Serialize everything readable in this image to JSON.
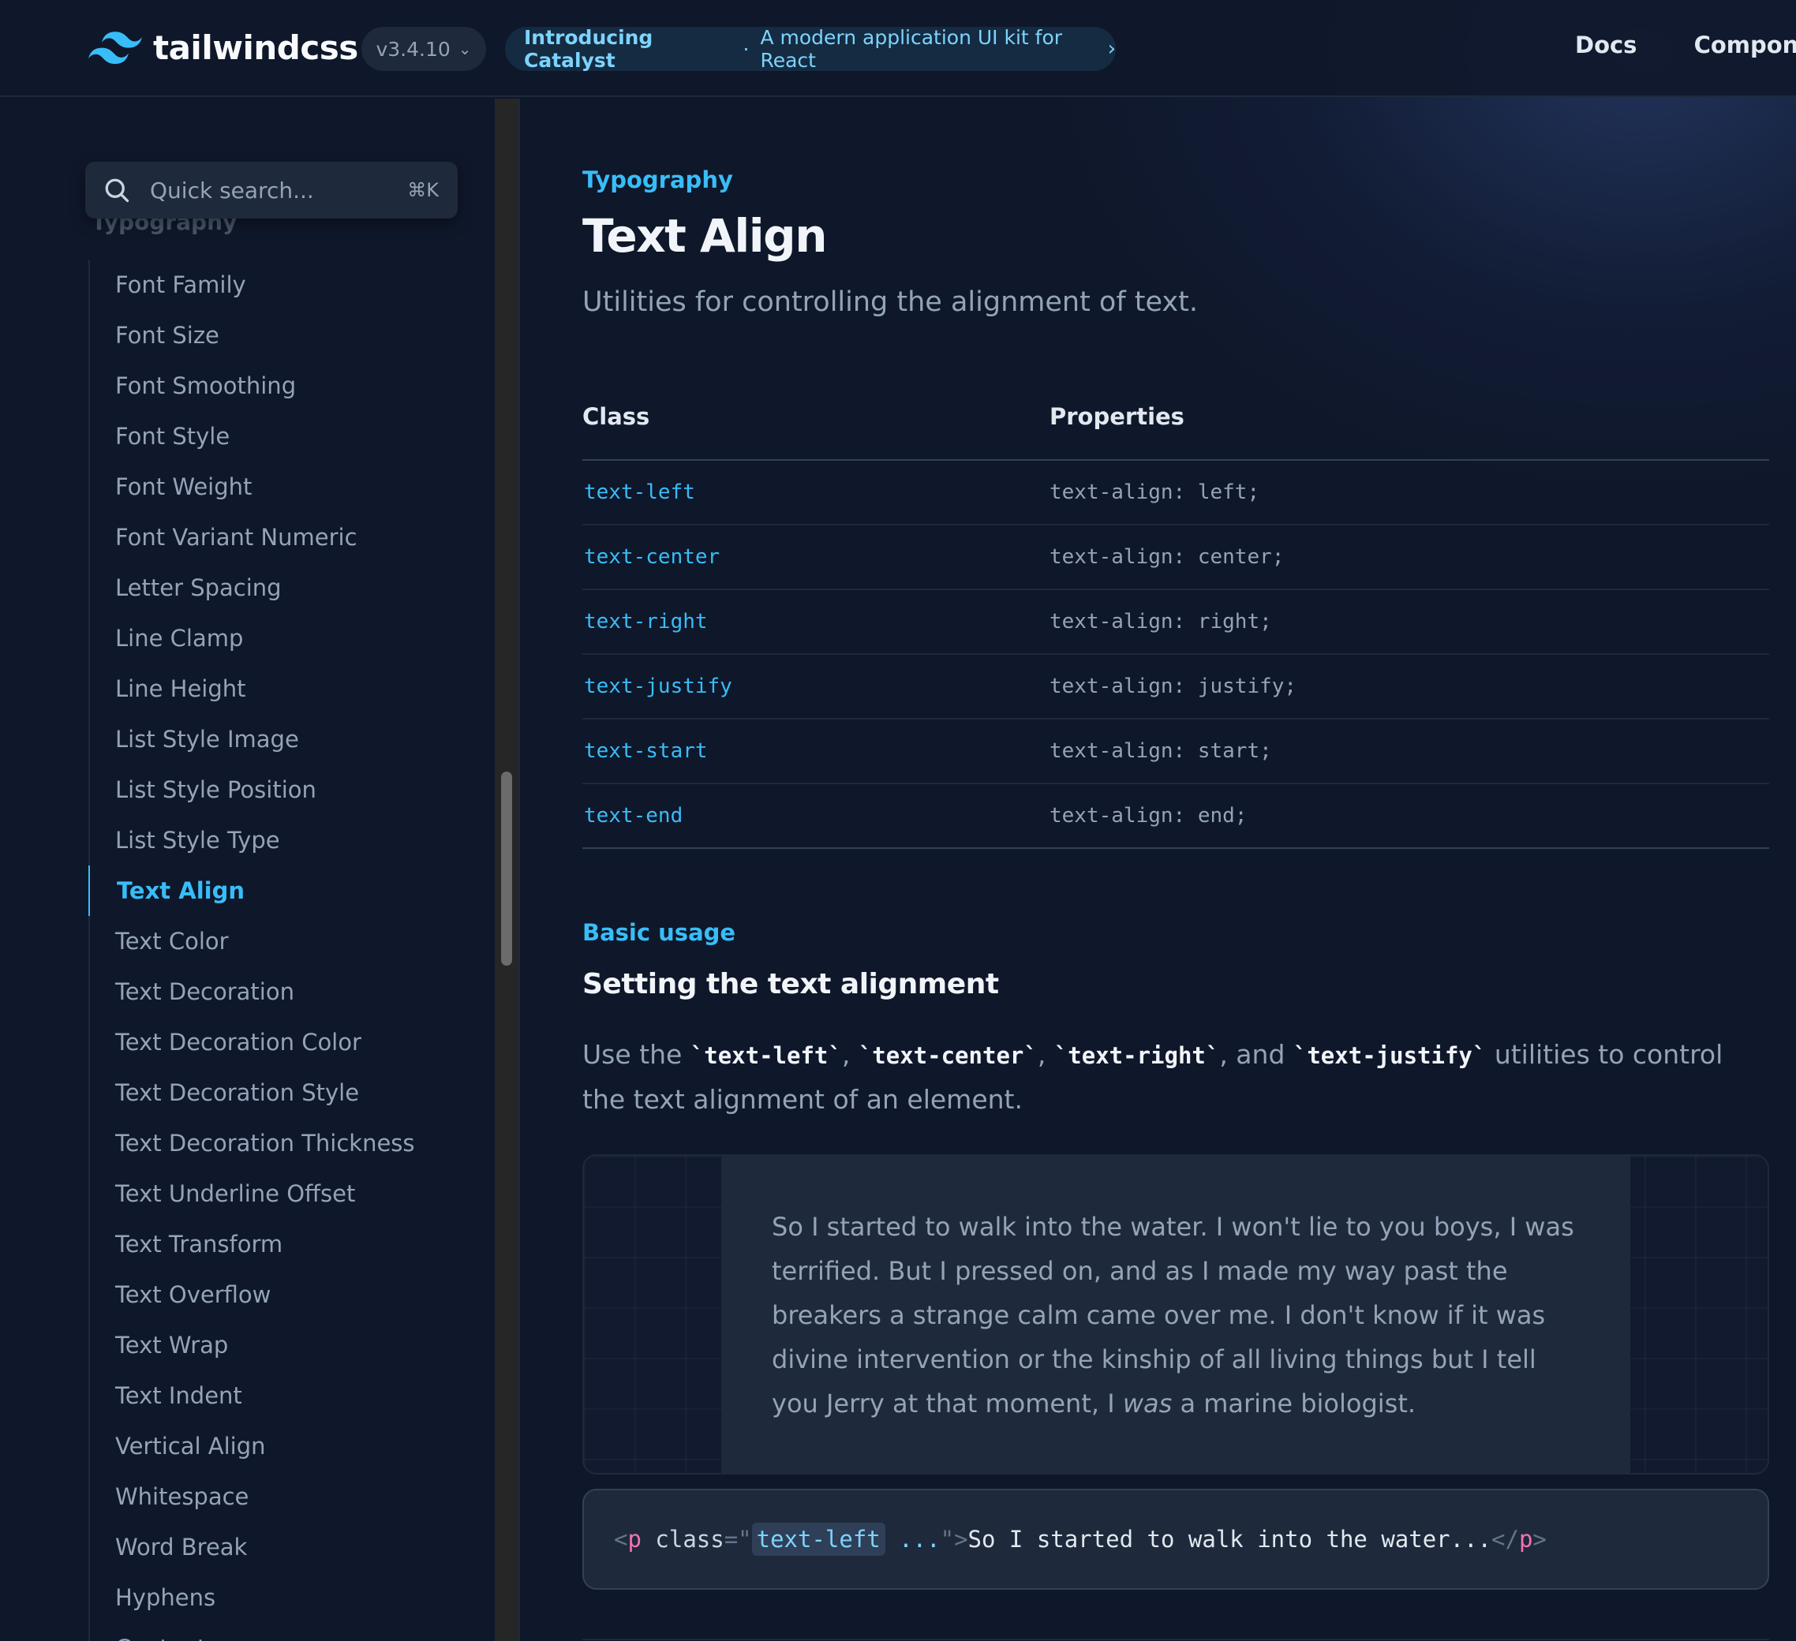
{
  "header": {
    "brand": "tailwindcss",
    "version": "v3.4.10",
    "announcement": {
      "title": "Introducing Catalyst",
      "separator": "·",
      "text": "A modern application UI kit for React"
    },
    "nav": [
      "Docs",
      "Componen"
    ]
  },
  "sidebar": {
    "search": {
      "placeholder": "Quick search...",
      "shortcut": "⌘K"
    },
    "section_title": "Typography",
    "items": [
      "Font Family",
      "Font Size",
      "Font Smoothing",
      "Font Style",
      "Font Weight",
      "Font Variant Numeric",
      "Letter Spacing",
      "Line Clamp",
      "Line Height",
      "List Style Image",
      "List Style Position",
      "List Style Type",
      "Text Align",
      "Text Color",
      "Text Decoration",
      "Text Decoration Color",
      "Text Decoration Style",
      "Text Decoration Thickness",
      "Text Underline Offset",
      "Text Transform",
      "Text Overflow",
      "Text Wrap",
      "Text Indent",
      "Vertical Align",
      "Whitespace",
      "Word Break",
      "Hyphens",
      "Content"
    ],
    "active_item": "Text Align"
  },
  "main": {
    "eyebrow": "Typography",
    "title": "Text Align",
    "description": "Utilities for controlling the alignment of text.",
    "table": {
      "headers": [
        "Class",
        "Properties"
      ],
      "rows": [
        [
          "text-left",
          "text-align: left;"
        ],
        [
          "text-center",
          "text-align: center;"
        ],
        [
          "text-right",
          "text-align: right;"
        ],
        [
          "text-justify",
          "text-align: justify;"
        ],
        [
          "text-start",
          "text-align: start;"
        ],
        [
          "text-end",
          "text-align: end;"
        ]
      ]
    },
    "usage": {
      "eyebrow": "Basic usage",
      "title": "Setting the text alignment",
      "desc_parts": {
        "prefix": "Use the ",
        "code1": "`text-left`",
        "sep1": ", ",
        "code2": "`text-center`",
        "sep2": ", ",
        "code3": "`text-right`",
        "sep3": ", and ",
        "code4": "`text-justify`",
        "suffix": " utilities to control the text alignment of an element."
      },
      "demo": {
        "before": "So I started to walk into the water. I won't lie to you boys, I was terrified. But I pressed on, and as I made my way past the breakers a strange calm came over me. I don't know if it was divine intervention or the kinship of all living things but I tell you Jerry at that moment, I ",
        "emphasis": "was",
        "after": " a marine biologist."
      },
      "code": {
        "open": "<",
        "tag": "p",
        "attr": " class",
        "eq": "=\"",
        "class_value": "text-left",
        "rest": " ...",
        "close_quote": "\"",
        "gt": ">",
        "content": "So I started to walk into the water...",
        "end_open": "</",
        "end_tag": "p",
        "end_gt": ">"
      }
    }
  },
  "colors": {
    "background": "#0f172a",
    "accent": "#38bdf8",
    "surface": "#1e293b",
    "tag": "#f472b6"
  }
}
